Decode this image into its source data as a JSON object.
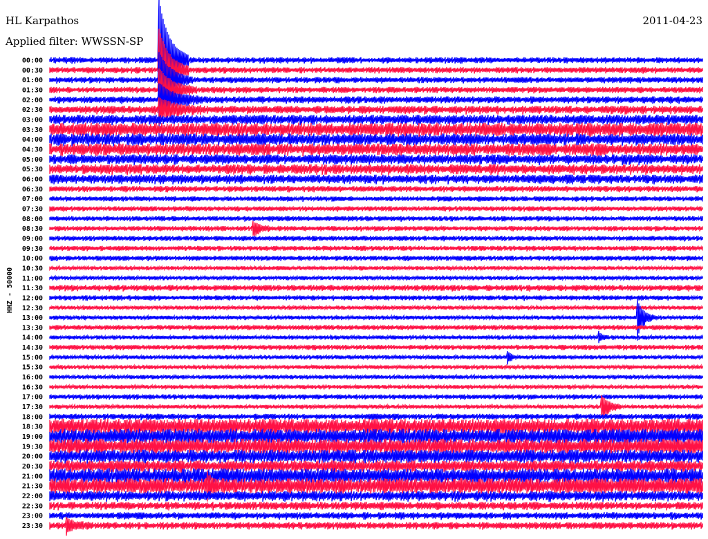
{
  "header": {
    "station": "HL Karpathos",
    "filter": "Applied filter: WWSSN-SP",
    "date": "2011-04-23"
  },
  "chart_data": {
    "type": "line",
    "title": "HL Karpathos",
    "subtitle": "Applied filter: WWSSN-SP",
    "ylabel": "HHZ - 50000",
    "row_minutes": 30,
    "colors": [
      "#0000ff",
      "#ff1144"
    ],
    "rows": [
      "00:00",
      "00:30",
      "01:00",
      "01:30",
      "02:00",
      "02:30",
      "03:00",
      "03:30",
      "04:00",
      "04:30",
      "05:00",
      "05:30",
      "06:00",
      "06:30",
      "07:00",
      "07:30",
      "08:00",
      "08:30",
      "09:00",
      "09:30",
      "10:00",
      "10:30",
      "11:00",
      "11:30",
      "12:00",
      "12:30",
      "13:00",
      "13:30",
      "14:00",
      "14:30",
      "15:00",
      "15:30",
      "16:00",
      "16:30",
      "17:00",
      "17:30",
      "18:00",
      "18:30",
      "19:00",
      "19:30",
      "20:00",
      "20:30",
      "21:00",
      "21:30",
      "22:00",
      "22:30",
      "23:00",
      "23:30"
    ],
    "noise_amplitude": [
      3,
      3,
      3,
      3,
      3.5,
      4,
      5,
      7,
      6,
      6,
      5,
      5,
      4.5,
      3,
      2.5,
      2.5,
      2.5,
      2.5,
      2.5,
      2.5,
      2.5,
      2,
      2,
      3,
      2.5,
      2,
      2,
      2.5,
      2,
      2.5,
      2,
      2,
      2,
      2,
      2.5,
      2,
      3,
      8,
      8,
      8,
      7,
      6,
      8,
      8,
      5,
      4,
      3.5,
      3.5
    ],
    "events": [
      {
        "row": 0,
        "minute": 5.0,
        "amp": 90,
        "duration": 1.4
      },
      {
        "row": 1,
        "minute": 5.0,
        "amp": 60,
        "duration": 1.4
      },
      {
        "row": 2,
        "minute": 5.0,
        "amp": 40,
        "duration": 1.6
      },
      {
        "row": 3,
        "minute": 5.0,
        "amp": 30,
        "duration": 1.8
      },
      {
        "row": 4,
        "minute": 5.0,
        "amp": 22,
        "duration": 2.0
      },
      {
        "row": 5,
        "minute": 5.0,
        "amp": 15,
        "duration": 2.0
      },
      {
        "row": 17,
        "minute": 9.3,
        "amp": 9,
        "duration": 1.0
      },
      {
        "row": 26,
        "minute": 27.0,
        "amp": 25,
        "duration": 0.8
      },
      {
        "row": 28,
        "minute": 25.2,
        "amp": 9,
        "duration": 0.5
      },
      {
        "row": 30,
        "minute": 21.0,
        "amp": 9,
        "duration": 0.5
      },
      {
        "row": 35,
        "minute": 25.3,
        "amp": 18,
        "duration": 1.0
      },
      {
        "row": 43,
        "minute": 7.2,
        "amp": 14,
        "duration": 0.6
      },
      {
        "row": 47,
        "minute": 0.7,
        "amp": 10,
        "duration": 1.2
      }
    ]
  }
}
